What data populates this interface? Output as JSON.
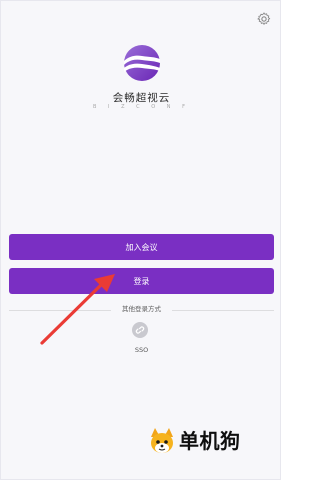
{
  "brand": {
    "name": "会畅超视云",
    "subtitle": "B I Z C O N F",
    "accent_color": "#7a2fc3"
  },
  "header": {
    "settings_icon": "gear-icon"
  },
  "actions": {
    "join_meeting_label": "加入会议",
    "login_label": "登录"
  },
  "other_login": {
    "label": "其他登录方式",
    "methods": [
      {
        "icon": "sso-icon",
        "label": "SSO"
      }
    ]
  },
  "watermark": {
    "text": "单机狗"
  }
}
